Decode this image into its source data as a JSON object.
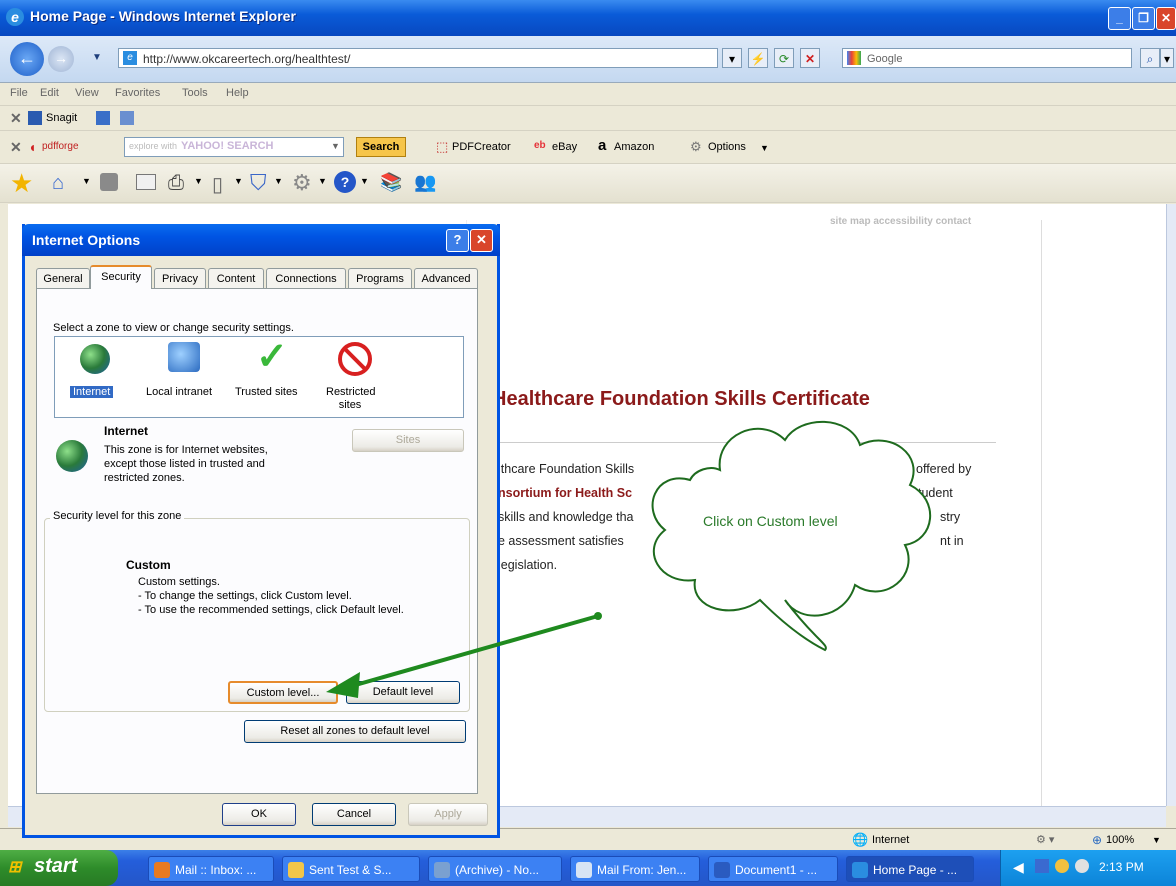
{
  "window": {
    "title": "Home Page - Windows Internet Explorer"
  },
  "address": {
    "url": "http://www.okcareertech.org/healthtest/",
    "search_placeholder": "Google"
  },
  "menu": [
    "File",
    "Edit",
    "View",
    "Favorites",
    "Tools",
    "Help"
  ],
  "snagit": {
    "label": "Snagit"
  },
  "pdfbar": {
    "brand": "pdfforge",
    "search_hint": "explore with",
    "yahoo": "YAHOO! SEARCH",
    "search_btn": "Search",
    "pdfcreator": "PDFCreator",
    "ebay": "eBay",
    "amazon": "Amazon",
    "options": "Options"
  },
  "page": {
    "top_links": "site map  accessibility  contact",
    "title": "Healthcare Foundation Skills Certificate",
    "lines": [
      "lthcare Foundation Skills",
      "offered by",
      "nsortium for Health Sc",
      "tudent",
      "skills and knowledge tha",
      "stry",
      "e assessment satisfies",
      "nt in",
      "legislation."
    ]
  },
  "callout": {
    "text": "Click on Custom level",
    "color": "#2a7a2a"
  },
  "dialog": {
    "title": "Internet Options",
    "tabs": [
      "General",
      "Security",
      "Privacy",
      "Content",
      "Connections",
      "Programs",
      "Advanced"
    ],
    "active_tab": "Security",
    "zone_prompt": "Select a zone to view or change security settings.",
    "zones": [
      "Internet",
      "Local intranet",
      "Trusted sites",
      "Restricted sites"
    ],
    "zone_name": "Internet",
    "zone_desc": [
      "This zone is for Internet websites,",
      "except those listed in trusted and",
      "restricted zones."
    ],
    "sites_btn": "Sites",
    "group_title": "Security level for this zone",
    "level_name": "Custom",
    "level_lines": [
      "Custom settings.",
      "- To change the settings, click Custom level.",
      "- To use the recommended settings, click Default level."
    ],
    "custom_btn": "Custom level...",
    "default_btn": "Default level",
    "reset_btn": "Reset all zones to default level",
    "ok": "OK",
    "cancel": "Cancel",
    "apply": "Apply"
  },
  "status": {
    "zone": "Internet",
    "zoom": "100%"
  },
  "taskbar": {
    "start": "start",
    "items": [
      "Mail :: Inbox: ...",
      "Sent Test & S...",
      "(Archive) - No...",
      "Mail From: Jen...",
      "Document1 - ...",
      "Home Page - ..."
    ],
    "clock": "2:13 PM"
  },
  "colors": {
    "accent": "#0054e3",
    "title_red": "#8b1a1a",
    "arrow_green": "#1f8a1f"
  }
}
